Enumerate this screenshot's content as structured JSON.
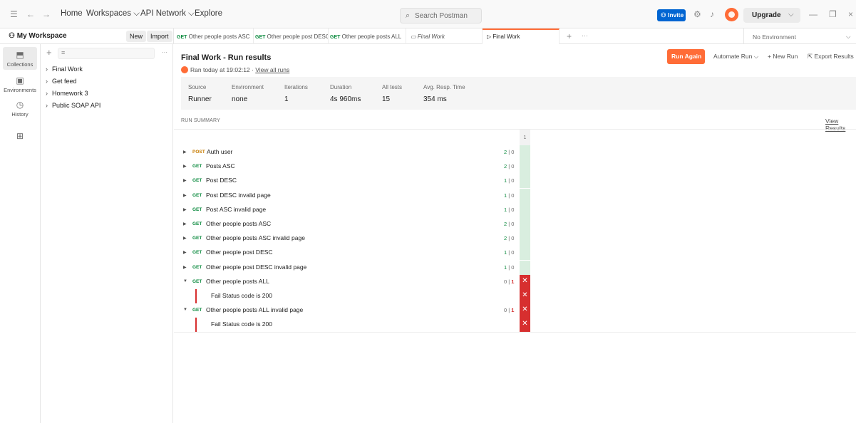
{
  "topbar": {
    "nav": [
      "Home",
      "Workspaces",
      "API Network",
      "Explore"
    ],
    "search_placeholder": "Search Postman",
    "invite_label": "Invite",
    "upgrade_label": "Upgrade"
  },
  "workspace": {
    "name": "My Workspace",
    "new_label": "New",
    "import_label": "Import"
  },
  "tabs": [
    {
      "method": "GET",
      "label": "Other people posts ASC"
    },
    {
      "method": "GET",
      "label": "Other people post DESC"
    },
    {
      "method": "GET",
      "label": "Other people posts ALL"
    },
    {
      "method": "",
      "label": "Final Work"
    },
    {
      "method": "",
      "label": "Final Work"
    }
  ],
  "environment": "No Environment",
  "rail": [
    "Collections",
    "Environments",
    "History"
  ],
  "sidebar": {
    "items": [
      "Final Work",
      "Get feed",
      "Homework 3",
      "Public SOAP API"
    ]
  },
  "run": {
    "title": "Final Work - Run results",
    "ran_text": "Ran today at 19:02:12",
    "view_all": "View all runs",
    "run_again": "Run Again",
    "automate": "Automate Run",
    "new_run": "New Run",
    "export": "Export Results"
  },
  "stats": [
    {
      "label": "Source",
      "value": "Runner"
    },
    {
      "label": "Environment",
      "value": "none"
    },
    {
      "label": "Iterations",
      "value": "1"
    },
    {
      "label": "Duration",
      "value": "4s 960ms"
    },
    {
      "label": "All tests",
      "value": "15"
    },
    {
      "label": "Avg. Resp. Time",
      "value": "354 ms"
    }
  ],
  "summary": {
    "heading": "RUN SUMMARY",
    "view_results": "View Results",
    "iteration": "1"
  },
  "requests": [
    {
      "method": "POST",
      "name": "Auth user",
      "pass": "2",
      "fail": "0"
    },
    {
      "method": "GET",
      "name": "Posts ASC",
      "pass": "2",
      "fail": "0"
    },
    {
      "method": "GET",
      "name": "Post DESC",
      "pass": "1",
      "fail": "0"
    },
    {
      "method": "GET",
      "name": "Post DESC invalid page",
      "pass": "1",
      "fail": "0"
    },
    {
      "method": "GET",
      "name": "Post ASC invalid page",
      "pass": "1",
      "fail": "0"
    },
    {
      "method": "GET",
      "name": "Other people posts ASC",
      "pass": "2",
      "fail": "0"
    },
    {
      "method": "GET",
      "name": "Other people posts ASC invalid page",
      "pass": "2",
      "fail": "0"
    },
    {
      "method": "GET",
      "name": "Other people post DESC",
      "pass": "1",
      "fail": "0"
    },
    {
      "method": "GET",
      "name": "Other people post DESC invalid page",
      "pass": "1",
      "fail": "0"
    },
    {
      "method": "GET",
      "name": "Other people posts ALL",
      "pass": "0",
      "fail": "1",
      "failure": "Fail  Status code is 200"
    },
    {
      "method": "GET",
      "name": "Other people posts ALL invalid page",
      "pass": "0",
      "fail": "1",
      "failure": "Fail  Status code is 200"
    }
  ],
  "colors": {
    "accent": "#ff6c37",
    "get": "#0b8a3e",
    "post": "#c77c02",
    "fail": "#d72f2f",
    "pass_cell": "#d9eedf",
    "invite": "#0265d2"
  }
}
